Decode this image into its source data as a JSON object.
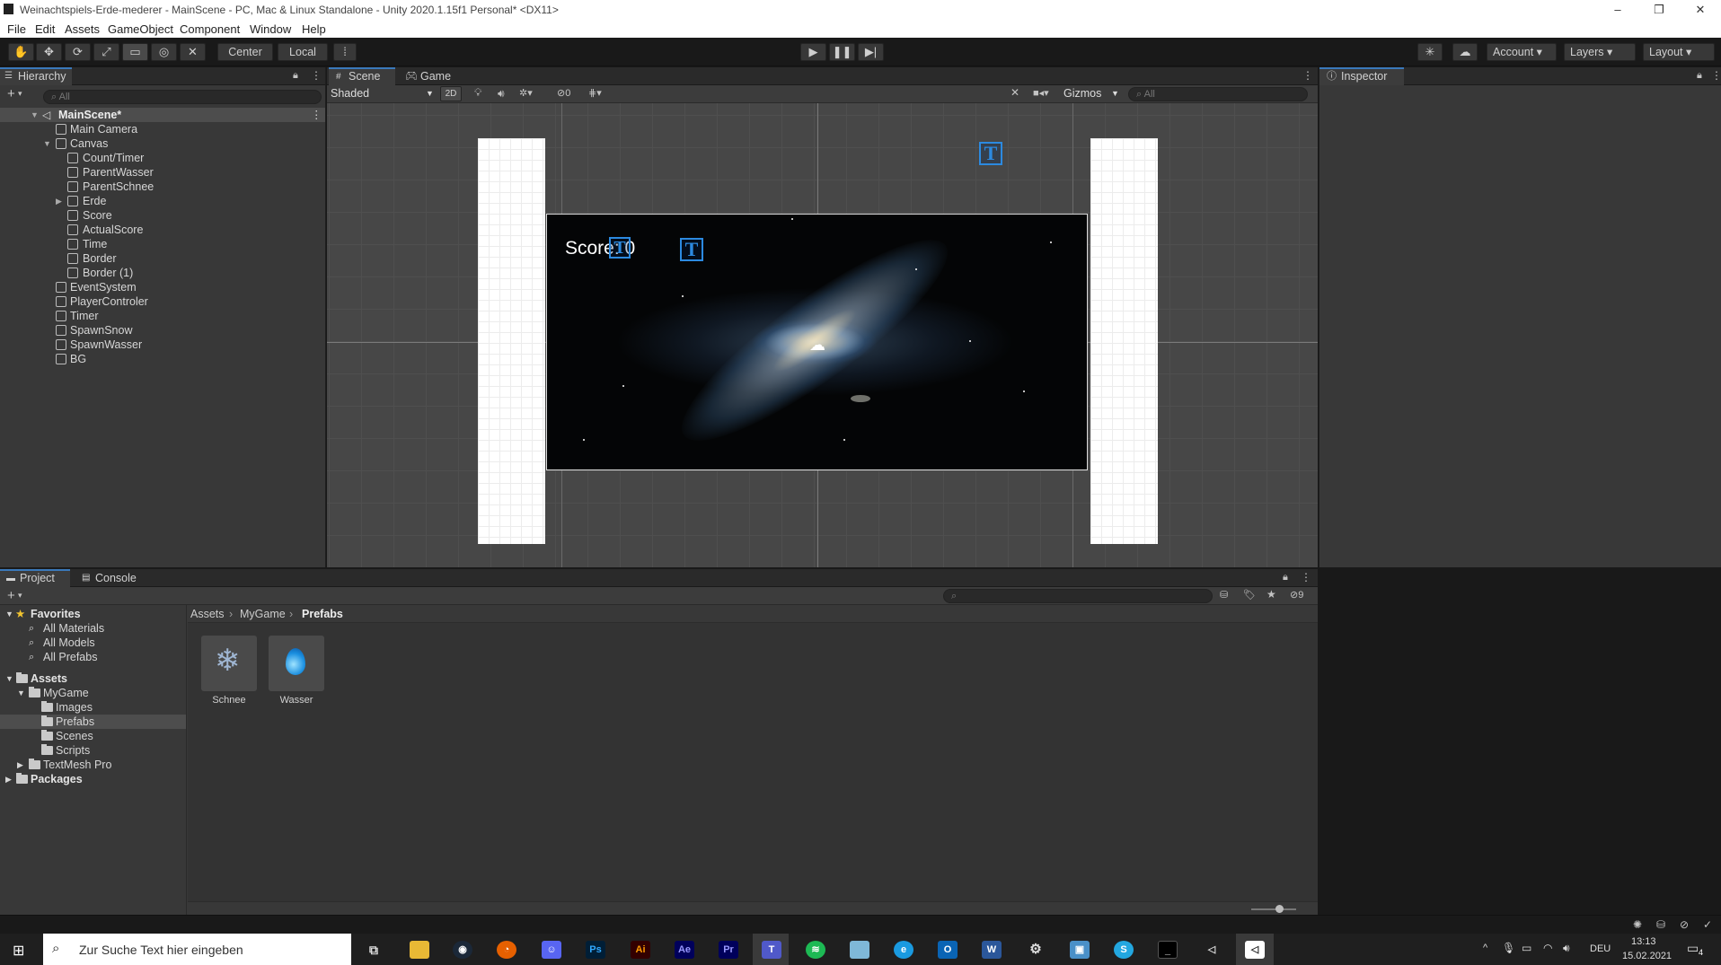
{
  "window": {
    "title": "Weinachtspiels-Erde-mederer - MainScene - PC, Mac & Linux Standalone - Unity 2020.1.15f1 Personal* <DX11>",
    "controls": [
      "–",
      "❐",
      "✕"
    ]
  },
  "menu": [
    "File",
    "Edit",
    "Assets",
    "GameObject",
    "Component",
    "Window",
    "Help"
  ],
  "toolbar": {
    "pivot": "Center",
    "space": "Local",
    "account": "Account",
    "layers": "Layers",
    "layout": "Layout"
  },
  "hierarchy": {
    "tab": "Hierarchy",
    "search_placeholder": "All",
    "add": "+",
    "scene": "MainScene*",
    "items": [
      {
        "label": "Main Camera"
      },
      {
        "label": "Canvas"
      },
      {
        "label": "Count/Timer"
      },
      {
        "label": "ParentWasser"
      },
      {
        "label": "ParentSchnee"
      },
      {
        "label": "Erde"
      },
      {
        "label": "Score"
      },
      {
        "label": "ActualScore"
      },
      {
        "label": "Time"
      },
      {
        "label": "Border"
      },
      {
        "label": "Border (1)"
      },
      {
        "label": "EventSystem"
      },
      {
        "label": "PlayerControler"
      },
      {
        "label": "Timer"
      },
      {
        "label": "SpawnSnow"
      },
      {
        "label": "SpawnWasser"
      },
      {
        "label": "BG"
      }
    ]
  },
  "scene": {
    "tabs": [
      "Scene",
      "Game"
    ],
    "draw_mode": "Shaded",
    "mode_2d": "2D",
    "hidden_count": "0",
    "gizmos": "Gizmos",
    "search_placeholder": "All",
    "score_text": "Score: 0"
  },
  "inspector": {
    "tab": "Inspector"
  },
  "project": {
    "tabs": [
      "Project",
      "Console"
    ],
    "hidden_count": "9",
    "favorites": {
      "label": "Favorites",
      "items": [
        "All Materials",
        "All Models",
        "All Prefabs"
      ]
    },
    "assets": {
      "label": "Assets",
      "mygame": "MyGame",
      "folders": [
        "Images",
        "Prefabs",
        "Scenes",
        "Scripts"
      ],
      "textmesh": "TextMesh Pro"
    },
    "packages": "Packages",
    "breadcrumb": [
      "Assets",
      "MyGame",
      "Prefabs"
    ],
    "files": [
      {
        "name": "Schnee"
      },
      {
        "name": "Wasser"
      }
    ]
  },
  "taskbar": {
    "search_placeholder": "Zur Suche Text hier eingeben",
    "lang": "DEU",
    "time": "13:13",
    "date": "15.02.2021",
    "notif": "4"
  },
  "colors": {
    "accent": "#3a79bb",
    "selection": "#4d4d4d",
    "textmesh_icon": "#2c8ae0"
  }
}
